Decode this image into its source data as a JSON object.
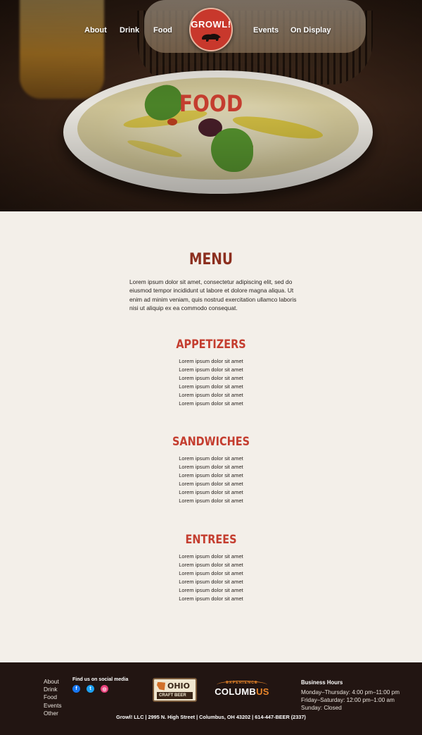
{
  "nav": {
    "items": [
      "About",
      "Drink",
      "Food",
      "Events",
      "On Display"
    ]
  },
  "logo": {
    "text": "GROWL!"
  },
  "hero": {
    "title": "FOOD"
  },
  "menu": {
    "title": "MENU",
    "intro": "Lorem ipsum dolor sit amet, consectetur adipiscing elit, sed do eiusmod tempor incididunt ut labore et dolore magna aliqua. Ut enim ad minim veniam, quis nostrud exercitation ullamco laboris nisi ut aliquip ex ea commodo consequat."
  },
  "sections": [
    {
      "title": "APPETIZERS",
      "items": [
        "Lorem ipsum dolor sit amet",
        "Lorem ipsum dolor sit amet",
        "Lorem ipsum dolor sit amet",
        "Lorem ipsum dolor sit amet",
        "Lorem ipsum dolor sit amet",
        "Lorem ipsum dolor sit amet"
      ]
    },
    {
      "title": "SANDWICHES",
      "items": [
        "Lorem ipsum dolor sit amet",
        "Lorem ipsum dolor sit amet",
        "Lorem ipsum dolor sit amet",
        "Lorem ipsum dolor sit amet",
        "Lorem ipsum dolor sit amet",
        "Lorem ipsum dolor sit amet"
      ]
    },
    {
      "title": "ENTREES",
      "items": [
        "Lorem ipsum dolor sit amet",
        "Lorem ipsum dolor sit amet",
        "Lorem ipsum dolor sit amet",
        "Lorem ipsum dolor sit amet",
        "Lorem ipsum dolor sit amet",
        "Lorem ipsum dolor sit amet"
      ]
    }
  ],
  "footer": {
    "links": [
      "About",
      "Drink",
      "Food",
      "Events",
      "Other"
    ],
    "social_label": "Find us on social media",
    "social_icons": [
      "facebook-icon",
      "twitter-icon",
      "instagram-icon"
    ],
    "ohio_logo": {
      "word": "OHIO",
      "tagline": "CRAFT BEER"
    },
    "columbus_logo": {
      "top": "EXPERIENCE",
      "name_main": "COLUMB",
      "name_accent": "US"
    },
    "hours": {
      "title": "Business Hours",
      "lines": [
        "Monday–Thursday: 4:00 pm–11:00 pm",
        "Friday–Saturday: 12:00 pm–1:00 am",
        "Sunday: Closed"
      ]
    },
    "address": "Growl! LLC | 2995 N. High Street | Columbus, OH 43202 | 614-447-BEER (2337)"
  },
  "colors": {
    "accent_red": "#c43d2f",
    "menu_title_red": "#8c2f1f",
    "page_background": "#f3efe9",
    "footer_background": "#221512",
    "columbus_orange": "#e9862a"
  }
}
